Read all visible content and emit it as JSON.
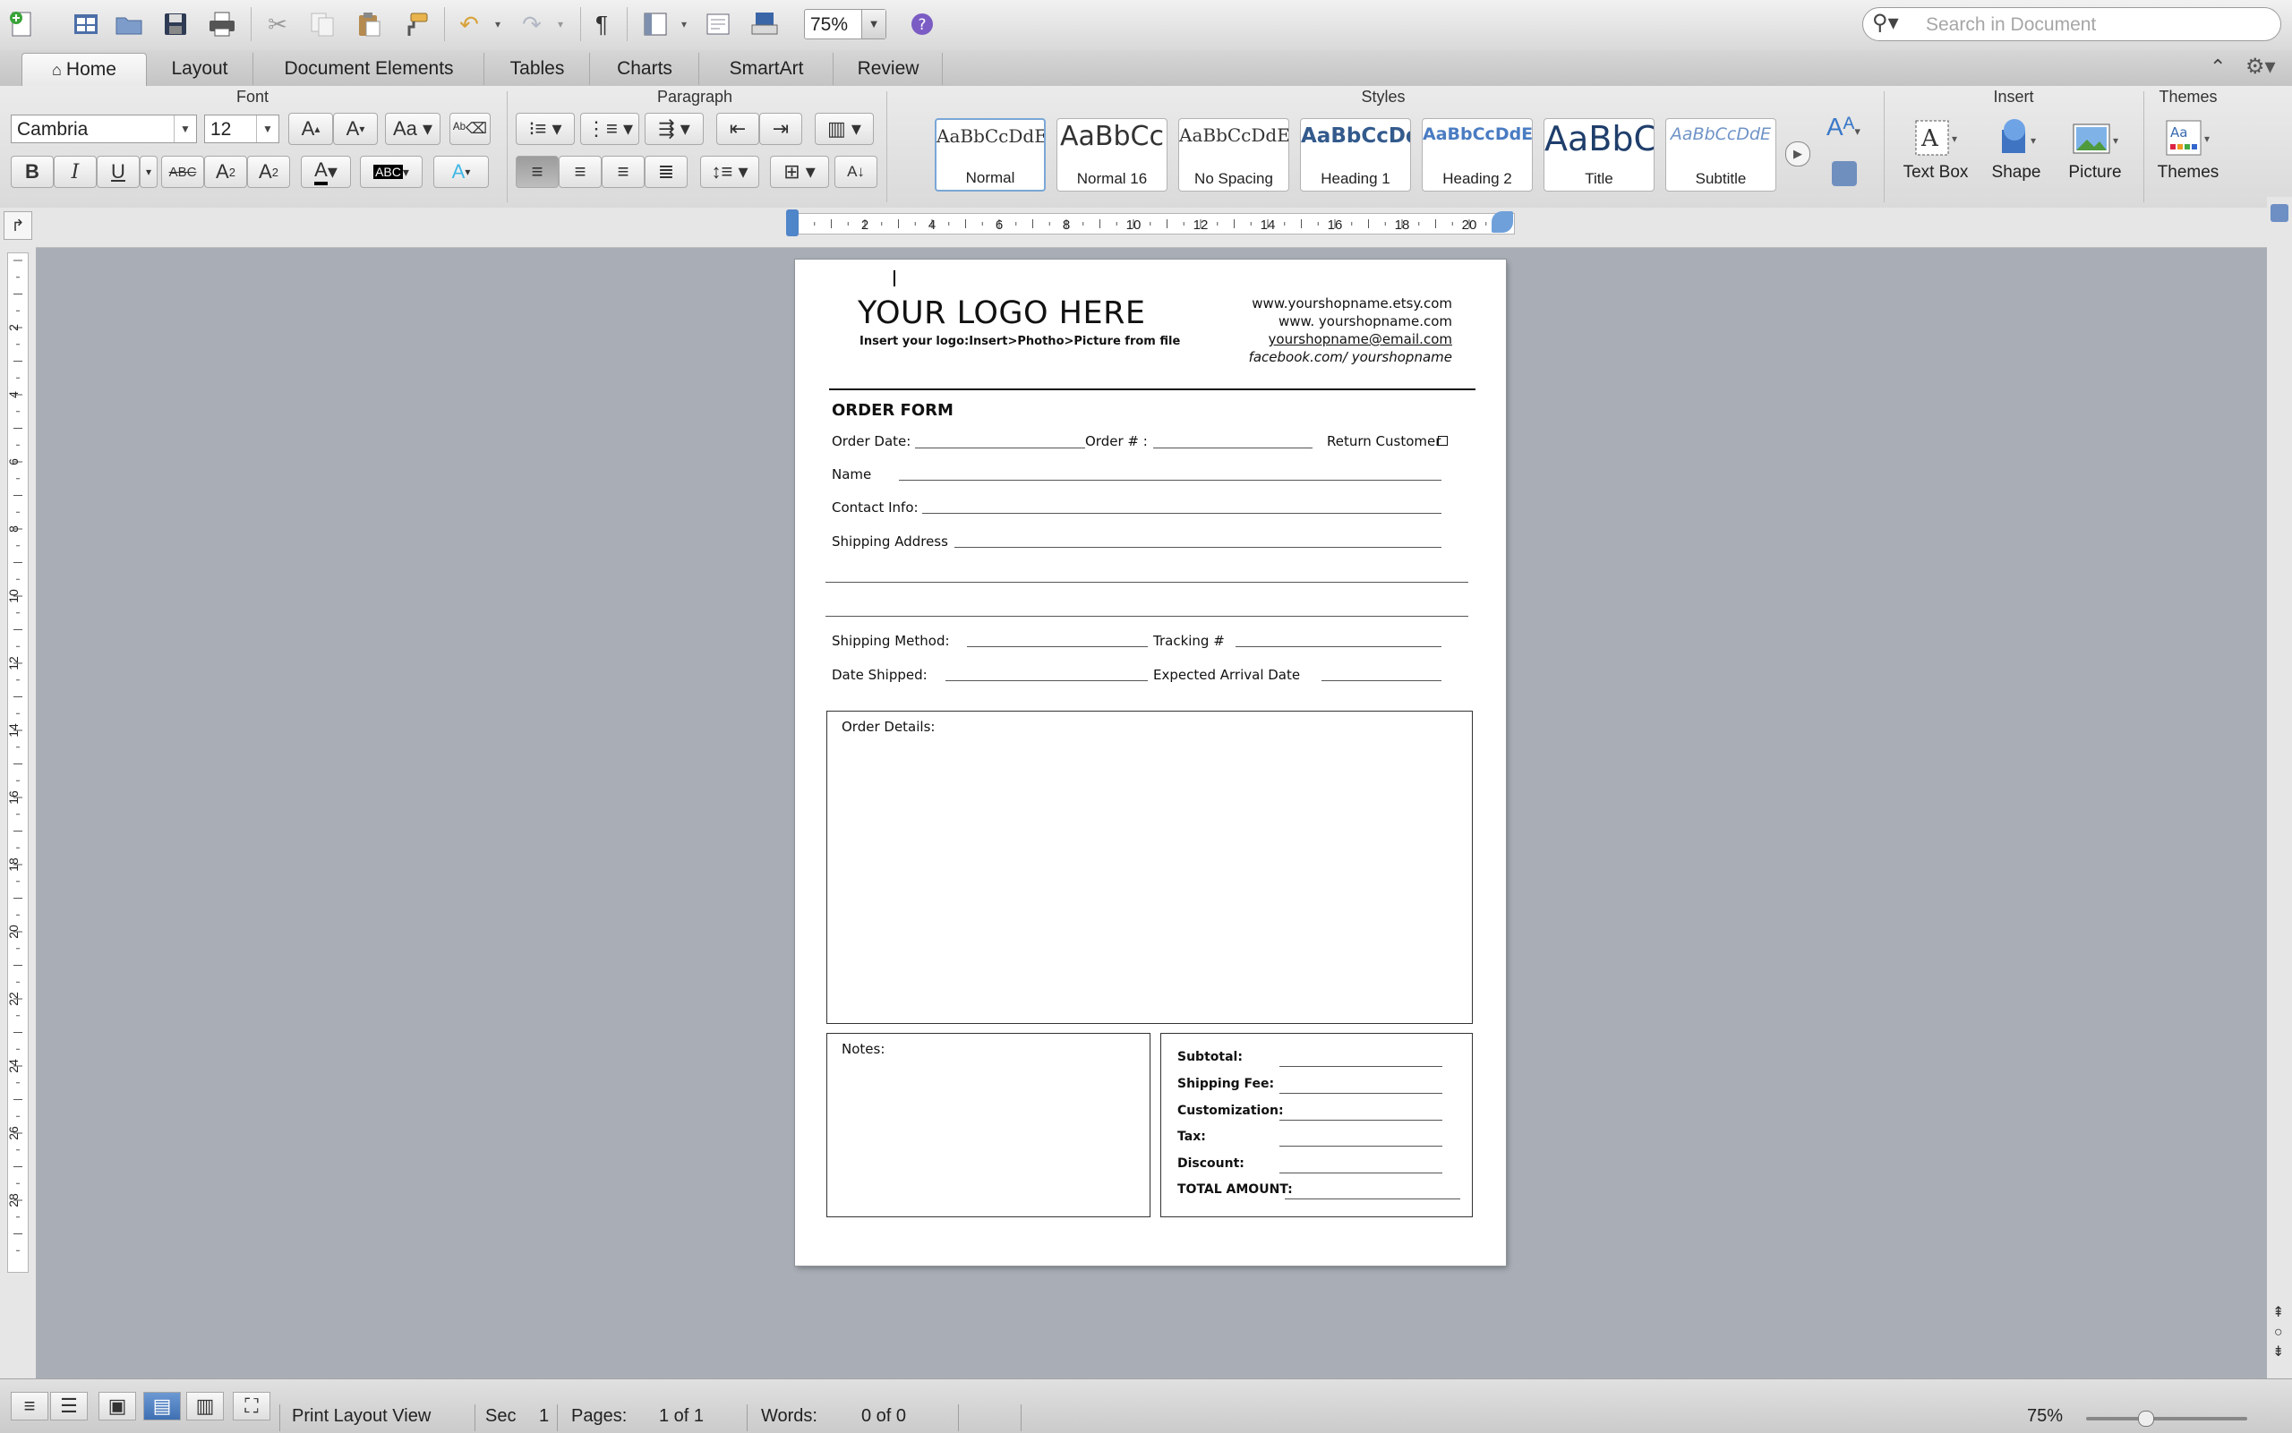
{
  "toolbar": {
    "zoom": "75%",
    "search_placeholder": "Search in Document"
  },
  "ribbon_tabs": [
    "Home",
    "Layout",
    "Document Elements",
    "Tables",
    "Charts",
    "SmartArt",
    "Review"
  ],
  "ribbon": {
    "groups": {
      "font": "Font",
      "paragraph": "Paragraph",
      "styles": "Styles",
      "insert": "Insert",
      "themes": "Themes"
    },
    "font_name": "Cambria",
    "font_size": "12",
    "styles": [
      {
        "preview": "AaBbCcDdEe",
        "name": "Normal"
      },
      {
        "preview": "AaBbCc",
        "name": "Normal 16"
      },
      {
        "preview": "AaBbCcDdEe",
        "name": "No Spacing"
      },
      {
        "preview": "AaBbCcDd",
        "name": "Heading 1"
      },
      {
        "preview": "AaBbCcDdEe",
        "name": "Heading 2"
      },
      {
        "preview": "AaBbC",
        "name": "Title"
      },
      {
        "preview": "AaBbCcDdE",
        "name": "Subtitle"
      }
    ],
    "insert_items": [
      "Text Box",
      "Shape",
      "Picture"
    ],
    "themes_label": "Themes"
  },
  "ruler": {
    "h_numbers": [
      "2",
      "4",
      "6",
      "8",
      "10",
      "12",
      "14",
      "16",
      "18",
      "20"
    ],
    "v_numbers": [
      "2",
      "4",
      "6",
      "8",
      "10",
      "12",
      "14",
      "16",
      "18",
      "20",
      "22",
      "24",
      "26",
      "28"
    ]
  },
  "document": {
    "logo_title": "YOUR LOGO HERE",
    "logo_subtitle": "Insert your logo:Insert>Photho>Picture from file",
    "contact_lines": [
      "www.yourshopname.etsy.com",
      "www. yourshopname.com",
      "yourshopname@email.com",
      "facebook.com/ yourshopname"
    ],
    "form_title": "ORDER FORM",
    "fields": {
      "order_date": "Order Date:",
      "order_no": "Order # :",
      "return_customer": "Return Customer",
      "name": "Name",
      "contact_info": "Contact Info:",
      "shipping_address": "Shipping Address",
      "shipping_method": "Shipping Method:",
      "tracking": "Tracking #",
      "date_shipped": "Date Shipped:",
      "expected_arrival": "Expected Arrival Date"
    },
    "order_details_label": "Order Details:",
    "notes_label": "Notes:",
    "totals": [
      "Subtotal:",
      "Shipping Fee:",
      "Customization:",
      "Tax:",
      "Discount:",
      "TOTAL AMOUNT:"
    ]
  },
  "status_bar": {
    "view": "Print Layout View",
    "sec_label": "Sec",
    "sec_value": "1",
    "pages_label": "Pages:",
    "pages_value": "1 of 1",
    "words_label": "Words:",
    "words_value": "0 of 0",
    "zoom": "75%"
  }
}
